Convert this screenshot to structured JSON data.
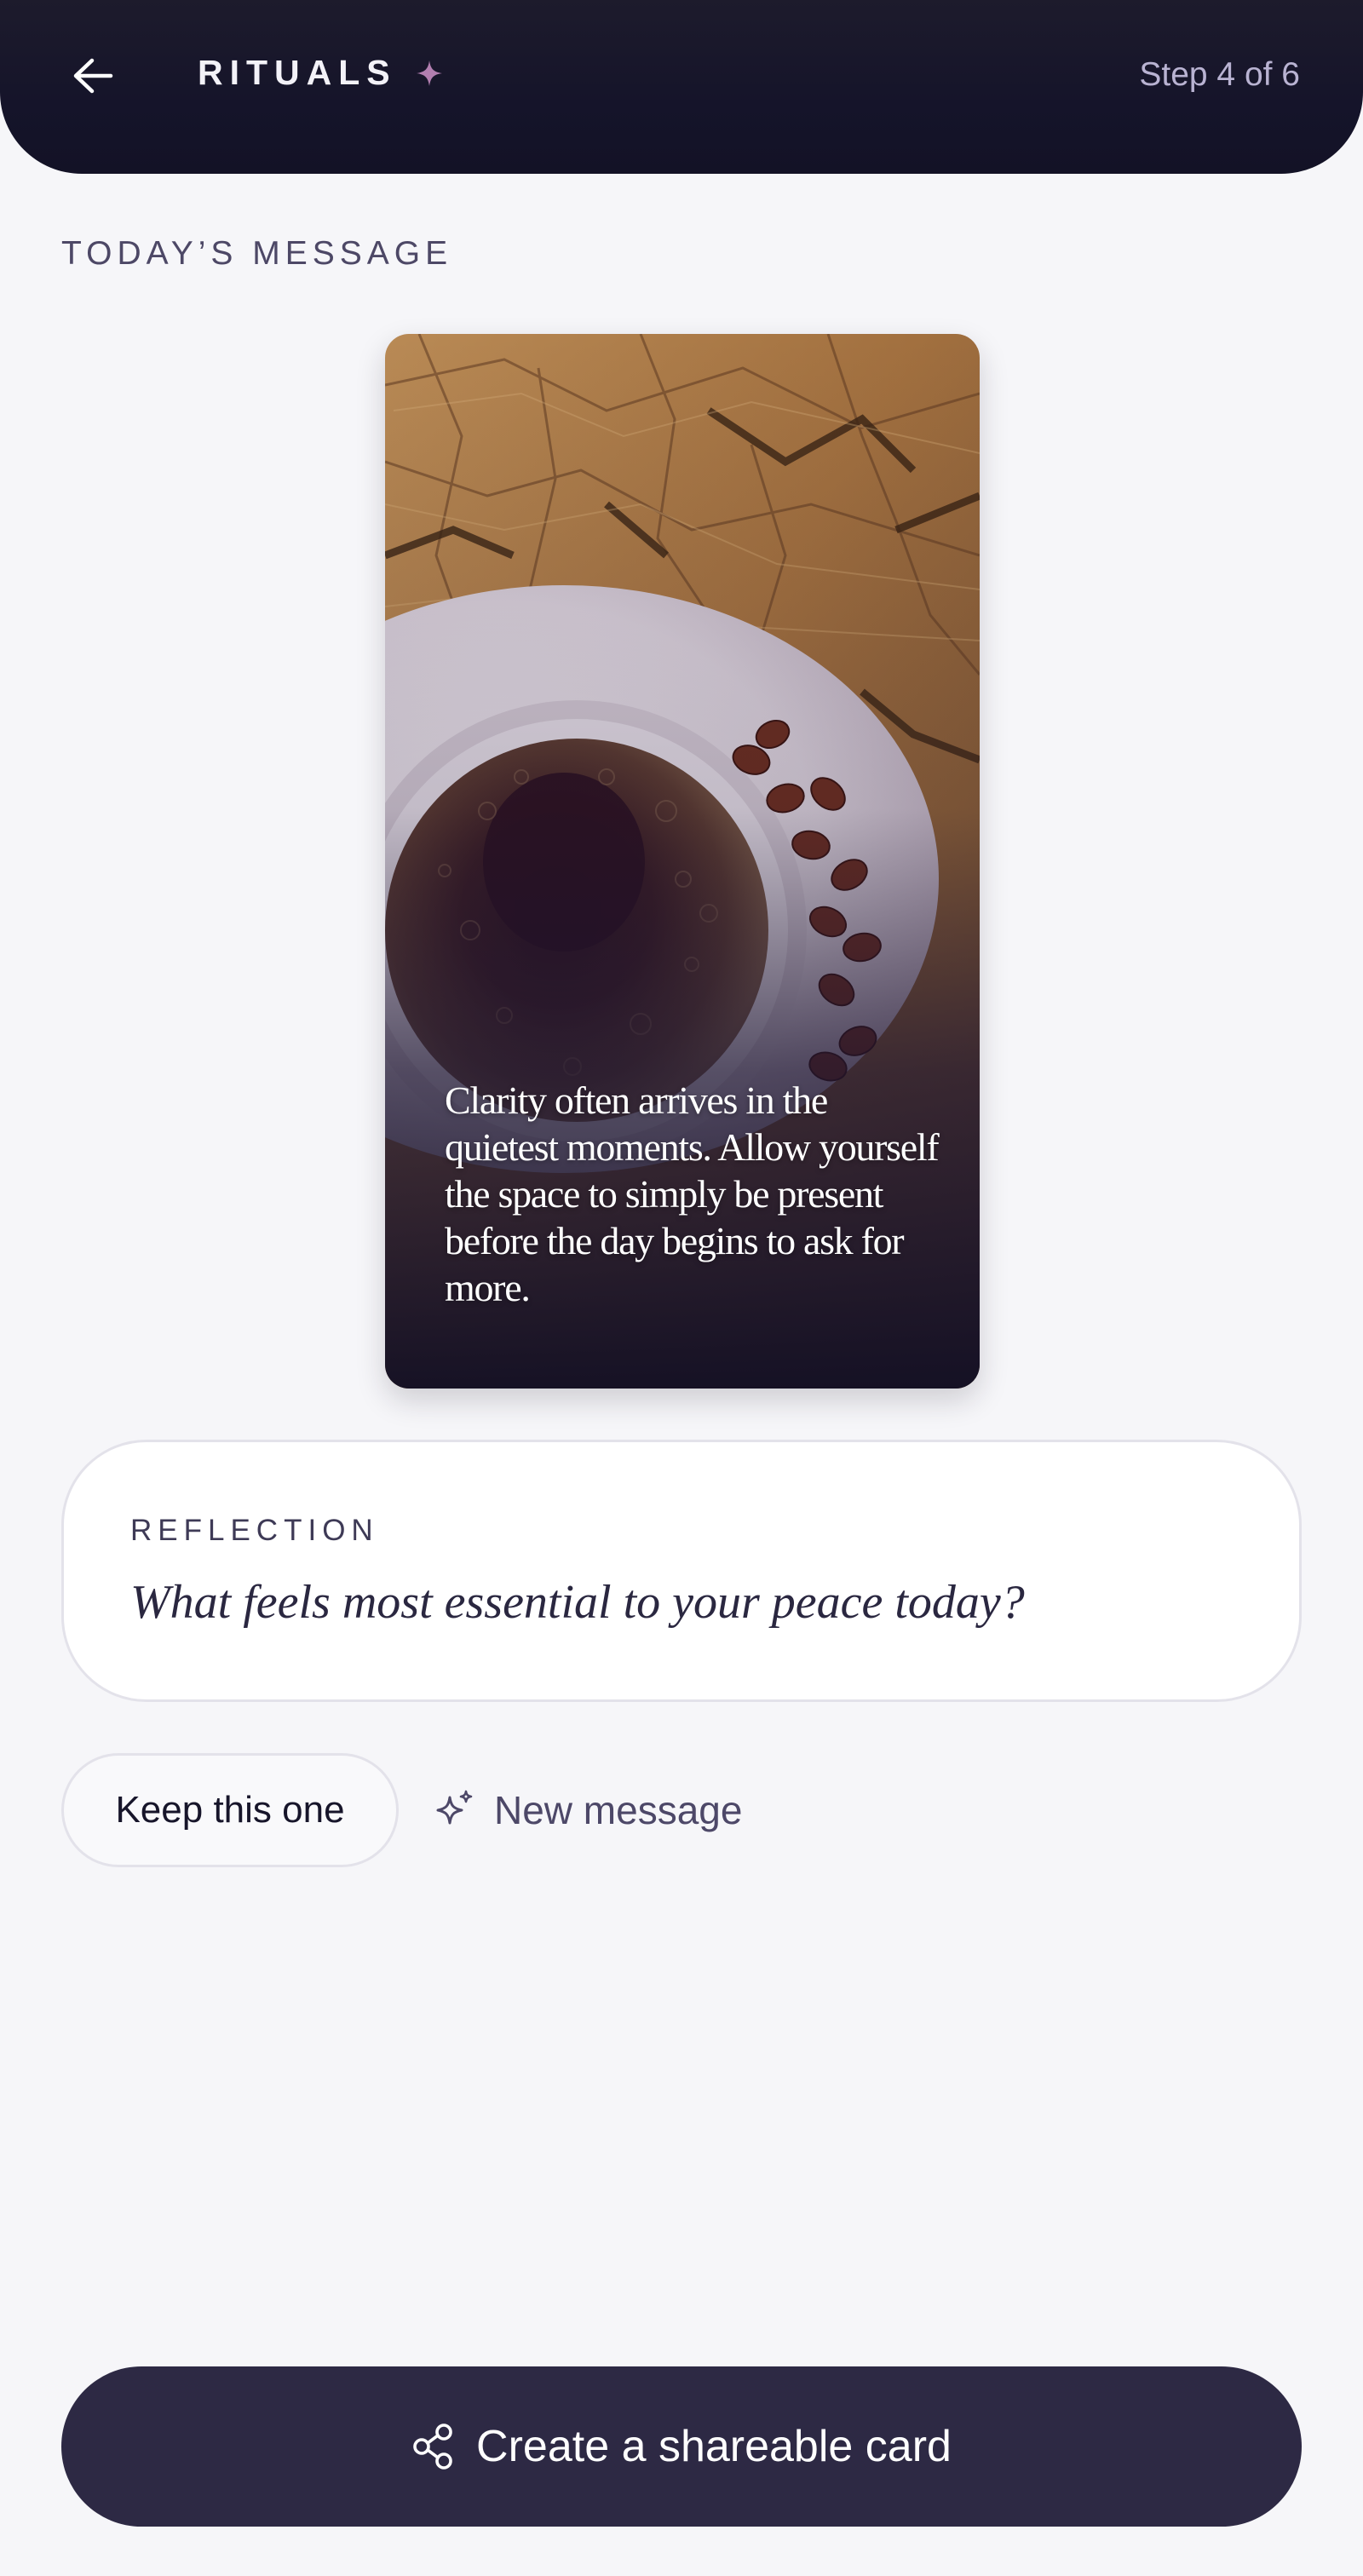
{
  "header": {
    "back_icon": "arrow-left-icon",
    "title": "RITUALS",
    "title_icon": "sparkle-icon",
    "step": "Step 4 of 6"
  },
  "section_label": "TODAY’S MESSAGE",
  "message_card": {
    "image": "coffee-cup-on-wood-photo",
    "text": "Clarity often arrives in the quietest moments. Allow yourself the space to simply be present before the day begins to ask for more."
  },
  "reflection": {
    "label": "REFLECTION",
    "question": "What feels most essential to your peace today?"
  },
  "actions": {
    "keep_label": "Keep this one",
    "new_label": "New message",
    "new_icon": "sparkles-icon"
  },
  "share": {
    "label": "Create a shareable card",
    "icon": "share-icon"
  },
  "colors": {
    "header_bg": "#15142a",
    "page_bg": "#f6f6f9",
    "accent_spark": "#b27fb0",
    "primary_button": "#2d2944"
  }
}
